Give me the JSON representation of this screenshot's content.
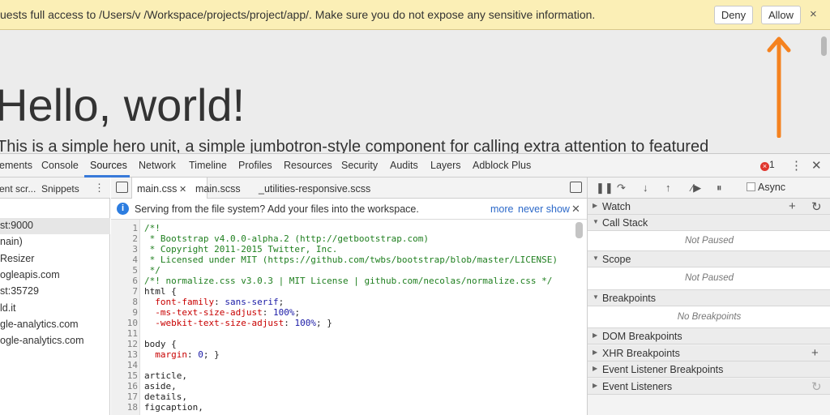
{
  "infobar": {
    "message": "uests full access to /Users/v  /Workspace/projects/project/app/. Make sure you do not expose any sensitive information.",
    "deny_label": "Deny",
    "allow_label": "Allow",
    "close_glyph": "×",
    "color": "#fbefb6"
  },
  "page": {
    "title": "Hello, world!",
    "subtitle": "This is a simple hero unit, a simple jumbotron-style component for calling extra attention to featured"
  },
  "annotation": {
    "arrow_color": "#f5821f"
  },
  "devtools": {
    "tabs": [
      "ements",
      "Console",
      "Sources",
      "Network",
      "Timeline",
      "Profiles",
      "Resources",
      "Security",
      "Audits",
      "Layers",
      "Adblock Plus"
    ],
    "active_tab": "Sources",
    "error_count": "1",
    "accent": "#3879d9"
  },
  "navigator": {
    "tabs": [
      "ent scr...",
      "Snippets"
    ],
    "items": [
      "st:9000",
      "nain)",
      "Resizer",
      "ogleapis.com",
      "st:35729",
      "ld.it",
      "gle-analytics.com",
      "ogle-analytics.com"
    ]
  },
  "editor": {
    "tabs": [
      "main.css",
      "main.scss",
      "_utilities-responsive.scss"
    ],
    "active_tab": "main.css",
    "notice": {
      "text": "Serving from the file system? Add your files into the workspace.",
      "link_more": "more",
      "link_never": "never show"
    },
    "lines": [
      {
        "n": "1",
        "t": "/*!"
      },
      {
        "n": "2",
        "t": " * Bootstrap v4.0.0-alpha.2 (http://getbootstrap.com)"
      },
      {
        "n": "3",
        "t": " * Copyright 2011-2015 Twitter, Inc."
      },
      {
        "n": "4",
        "t": " * Licensed under MIT (https://github.com/twbs/bootstrap/blob/master/LICENSE)"
      },
      {
        "n": "5",
        "t": " */"
      },
      {
        "n": "6",
        "t": "/*! normalize.css v3.0.3 | MIT License | github.com/necolas/normalize.css */"
      },
      {
        "n": "7",
        "t": "html {"
      },
      {
        "n": "8",
        "t": "  font-family: sans-serif;"
      },
      {
        "n": "9",
        "t": "  -ms-text-size-adjust: 100%;"
      },
      {
        "n": "10",
        "t": "  -webkit-text-size-adjust: 100%; }"
      },
      {
        "n": "11",
        "t": ""
      },
      {
        "n": "12",
        "t": "body {"
      },
      {
        "n": "13",
        "t": "  margin: 0; }"
      },
      {
        "n": "14",
        "t": ""
      },
      {
        "n": "15",
        "t": "article,"
      },
      {
        "n": "16",
        "t": "aside,"
      },
      {
        "n": "17",
        "t": "details,"
      },
      {
        "n": "18",
        "t": "figcaption,"
      }
    ]
  },
  "debugger": {
    "async_label": "Async",
    "panes": {
      "watch": "Watch",
      "call_stack": "Call Stack",
      "call_stack_body": "Not Paused",
      "scope": "Scope",
      "scope_body": "Not Paused",
      "breakpoints": "Breakpoints",
      "breakpoints_body": "No Breakpoints",
      "dom_breakpoints": "DOM Breakpoints",
      "xhr_breakpoints": "XHR Breakpoints",
      "event_listener_breakpoints": "Event Listener Breakpoints",
      "event_listeners": "Event Listeners"
    }
  }
}
